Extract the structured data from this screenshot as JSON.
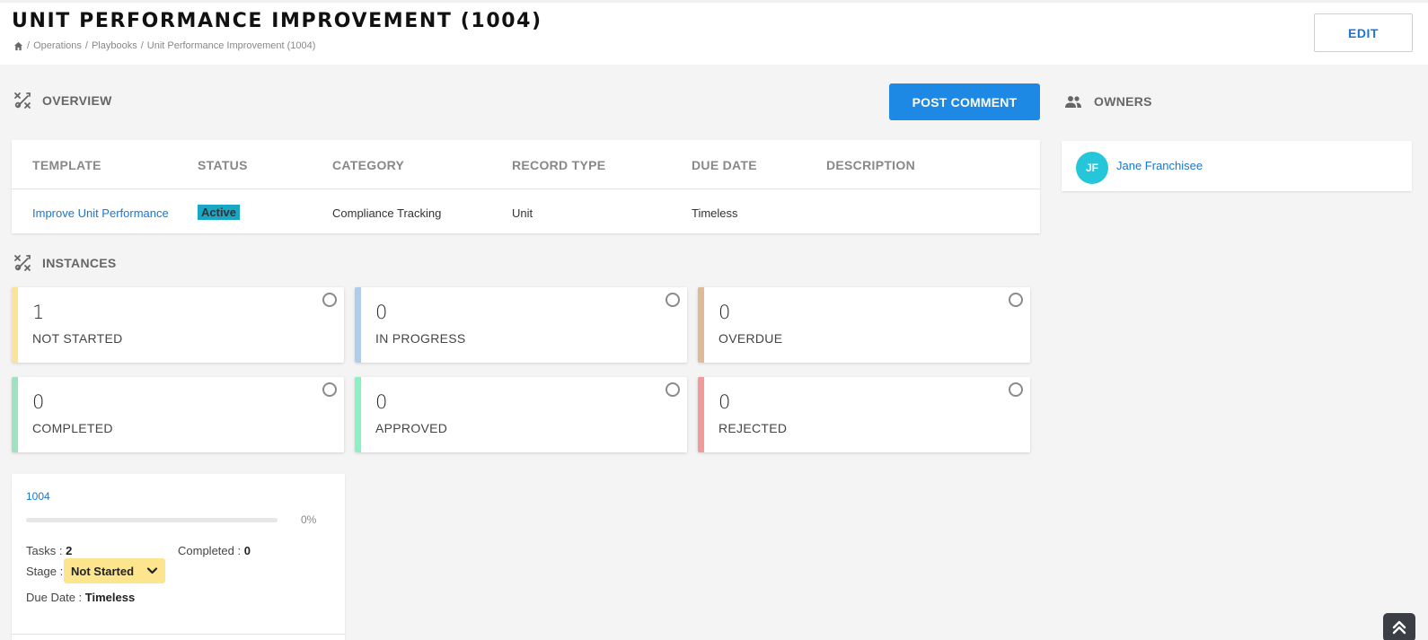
{
  "header": {
    "title": "UNIT PERFORMANCE IMPROVEMENT (1004)",
    "breadcrumb": [
      "Operations",
      "Playbooks",
      "Unit Performance Improvement (1004)"
    ],
    "edit_label": "EDIT"
  },
  "overview": {
    "heading": "OVERVIEW",
    "post_comment_label": "POST COMMENT",
    "columns": [
      "TEMPLATE",
      "STATUS",
      "CATEGORY",
      "RECORD TYPE",
      "DUE DATE",
      "DESCRIPTION"
    ],
    "row": {
      "template": "Improve Unit Performance",
      "status": "Active",
      "category": "Compliance Tracking",
      "record_type": "Unit",
      "due_date": "Timeless",
      "description": ""
    }
  },
  "owners": {
    "heading": "OWNERS",
    "items": [
      {
        "initials": "JF",
        "name": "Jane Franchisee"
      }
    ]
  },
  "instances": {
    "heading": "INSTANCES",
    "stats": [
      {
        "count": "1",
        "label": "NOT STARTED",
        "color": "#fbe39a"
      },
      {
        "count": "0",
        "label": "IN PROGRESS",
        "color": "#aecdee"
      },
      {
        "count": "0",
        "label": "OVERDUE",
        "color": "#ddbb97"
      },
      {
        "count": "0",
        "label": "COMPLETED",
        "color": "#9fe2bf"
      },
      {
        "count": "0",
        "label": "APPROVED",
        "color": "#8cf0c2"
      },
      {
        "count": "0",
        "label": "REJECTED",
        "color": "#f09a9a"
      }
    ],
    "card": {
      "id": "1004",
      "progress_percent": 0,
      "progress_text": "0%",
      "tasks_label": "Tasks :",
      "tasks_value": "2",
      "completed_label": "Completed :",
      "completed_value": "0",
      "stage_label": "Stage :",
      "stage_value": "Not Started",
      "due_label": "Due Date :",
      "due_value": "Timeless"
    }
  },
  "icons": {
    "home": "home-icon",
    "overview": "tools-icon",
    "instances": "tools-icon",
    "owners": "people-icon",
    "scroll_top": "double-chevron-up-icon"
  }
}
